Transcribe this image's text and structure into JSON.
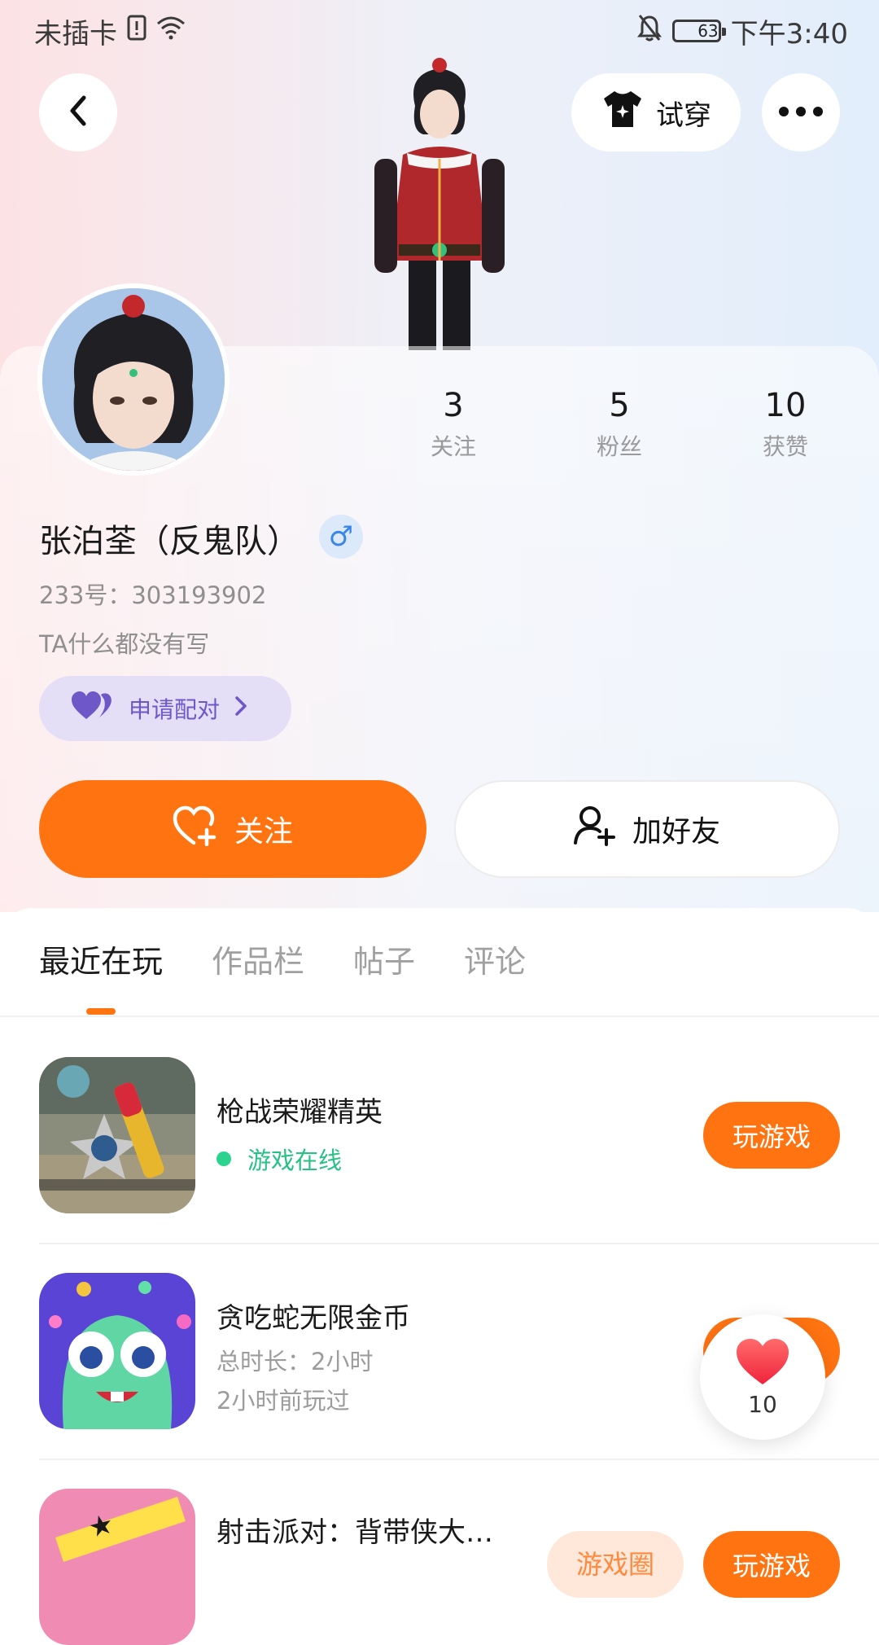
{
  "status_bar": {
    "carrier": "未插卡",
    "battery": "63",
    "time": "下午3:40"
  },
  "header": {
    "back_icon": "chevron-left-icon",
    "tryon_label": "试穿",
    "more_icon": "more-dots-icon"
  },
  "profile": {
    "stats": [
      {
        "value": "3",
        "label": "关注"
      },
      {
        "value": "5",
        "label": "粉丝"
      },
      {
        "value": "10",
        "label": "获赞"
      }
    ],
    "name": "张泊荃（反鬼队）",
    "gender_symbol": "♂",
    "uid": "233号：303193902",
    "bio": "TA什么都没有写",
    "pair_label": "申请配对",
    "follow_label": "关注",
    "add_friend_label": "加好友"
  },
  "tabs": [
    {
      "label": "最近在玩",
      "active": true
    },
    {
      "label": "作品栏",
      "active": false
    },
    {
      "label": "帖子",
      "active": false
    },
    {
      "label": "评论",
      "active": false
    }
  ],
  "games": [
    {
      "title": "枪战荣耀精英",
      "status": "游戏在线",
      "play_label": "玩游戏"
    },
    {
      "title": "贪吃蛇无限金币",
      "duration": "总时长：2小时",
      "last_played": "2小时前玩过",
      "play_label": "玩游戏"
    },
    {
      "title": "射击派对：背带侠大…",
      "tag_label": "游戏圈",
      "play_label": "玩游戏"
    }
  ],
  "like_float": {
    "count": "10"
  },
  "colors": {
    "accent": "#ff7311",
    "pair_bg": "#e4def6",
    "pair_text": "#6e58c8",
    "online_green": "#28c184"
  }
}
